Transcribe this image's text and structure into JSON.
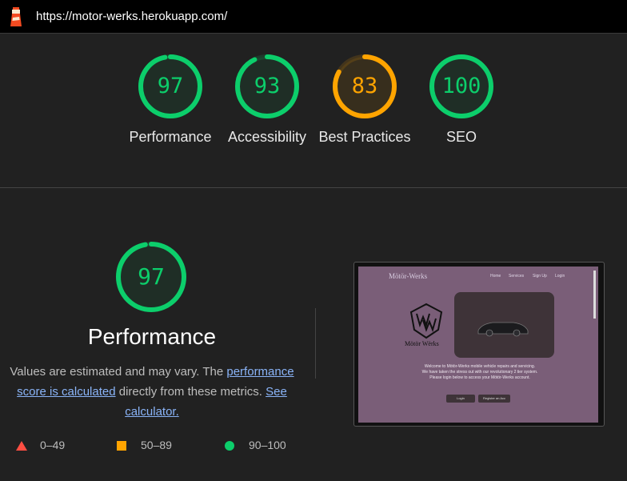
{
  "topbar": {
    "url": "https://motor-werks.herokuapp.com/",
    "icon": "lighthouse-icon"
  },
  "gauges": [
    {
      "score": "97",
      "label": "Performance",
      "color": "#0cce6b"
    },
    {
      "score": "93",
      "label": "Accessibility",
      "color": "#0cce6b"
    },
    {
      "score": "83",
      "label": "Best Practices",
      "color": "#ffa400"
    },
    {
      "score": "100",
      "label": "SEO",
      "color": "#0cce6b"
    }
  ],
  "performance": {
    "score": "97",
    "title": "Performance",
    "desc_prefix": "Values are estimated and may vary. The ",
    "link1": "performance score is calculated",
    "desc_mid": " directly from these metrics. ",
    "link2": "See calculator.",
    "color": "#0cce6b"
  },
  "legend": [
    {
      "range": "0–49",
      "shape": "triangle-icon",
      "color": "#ff4e42"
    },
    {
      "range": "50–89",
      "shape": "square-icon",
      "color": "#ffa400"
    },
    {
      "range": "90–100",
      "shape": "circle-icon",
      "color": "#0cce6b"
    }
  ],
  "screenshot": {
    "brand": "Mötör-Werks",
    "nav": [
      "Home",
      "Services",
      "Sign Up",
      "Login"
    ],
    "logo_text": "Mötör Wërks",
    "text_lines": [
      "Welcome to Mötör-Werks mobile vehicle repairs and servicing.",
      "We have taken the stress out with our revolutionary 2 tier system.",
      "Please login below to access your Mötör-Werks account."
    ],
    "buttons": [
      "Login",
      "Register an Acc"
    ]
  }
}
